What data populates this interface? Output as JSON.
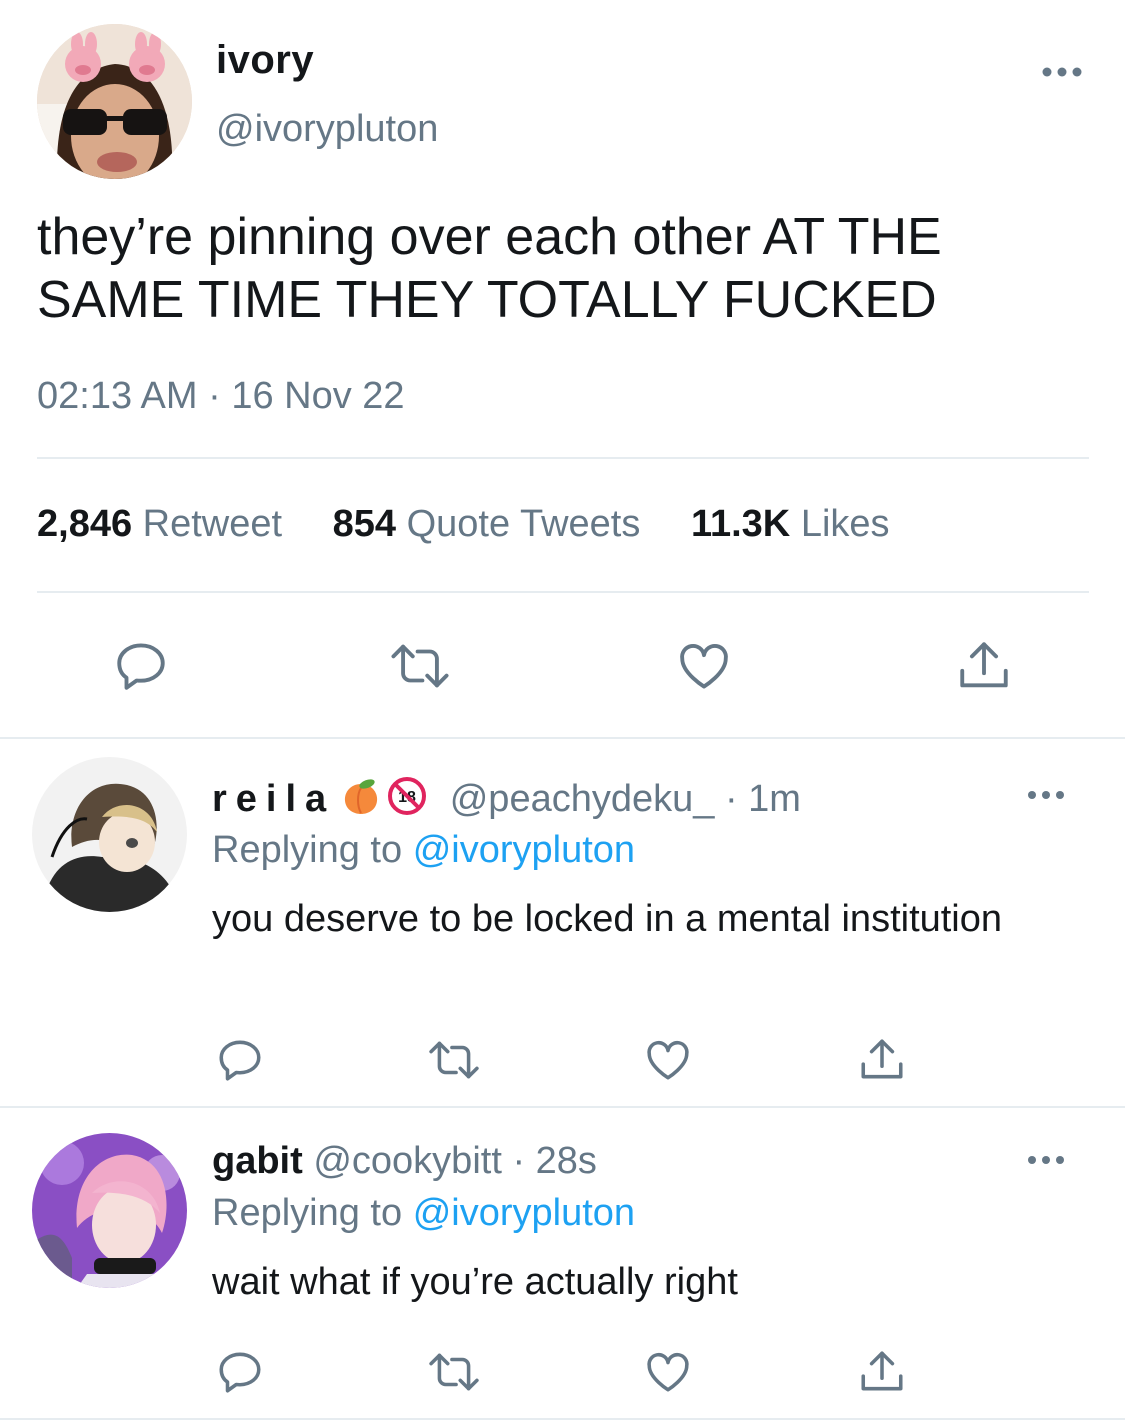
{
  "tweet": {
    "display_name": "ivory",
    "handle": "@ivorypluton",
    "text": "they’re pinning over each other AT THE SAME TIME THEY TOTALLY FUCKED",
    "timestamp": "02:13 AM · 16 Nov 22",
    "stats": {
      "retweets_count": "2,846",
      "retweets_label": "Retweet",
      "quotes_count": "854",
      "quotes_label": "Quote Tweets",
      "likes_count": "11.3K",
      "likes_label": "Likes"
    }
  },
  "replies": [
    {
      "display_name": "reila",
      "emojis": [
        "peach-emoji",
        "no-one-under-eighteen-emoji"
      ],
      "handle": "@peachydeku_",
      "time": "· 1m",
      "replying_prefix": "Replying to",
      "replying_to": "@ivorypluton",
      "text": "you deserve to be locked in a mental institution"
    },
    {
      "display_name": "gabit",
      "handle": "@cookybitt",
      "time": "· 28s",
      "replying_prefix": "Replying to",
      "replying_to": "@ivorypluton",
      "text": "wait what if you’re actually right"
    }
  ],
  "icons": [
    "reply-icon",
    "retweet-icon",
    "like-icon",
    "share-icon",
    "more-icon"
  ],
  "colors": {
    "text": "#14171a",
    "secondary": "#657786",
    "link": "#1da1f2",
    "divider": "#e6ecf0"
  }
}
